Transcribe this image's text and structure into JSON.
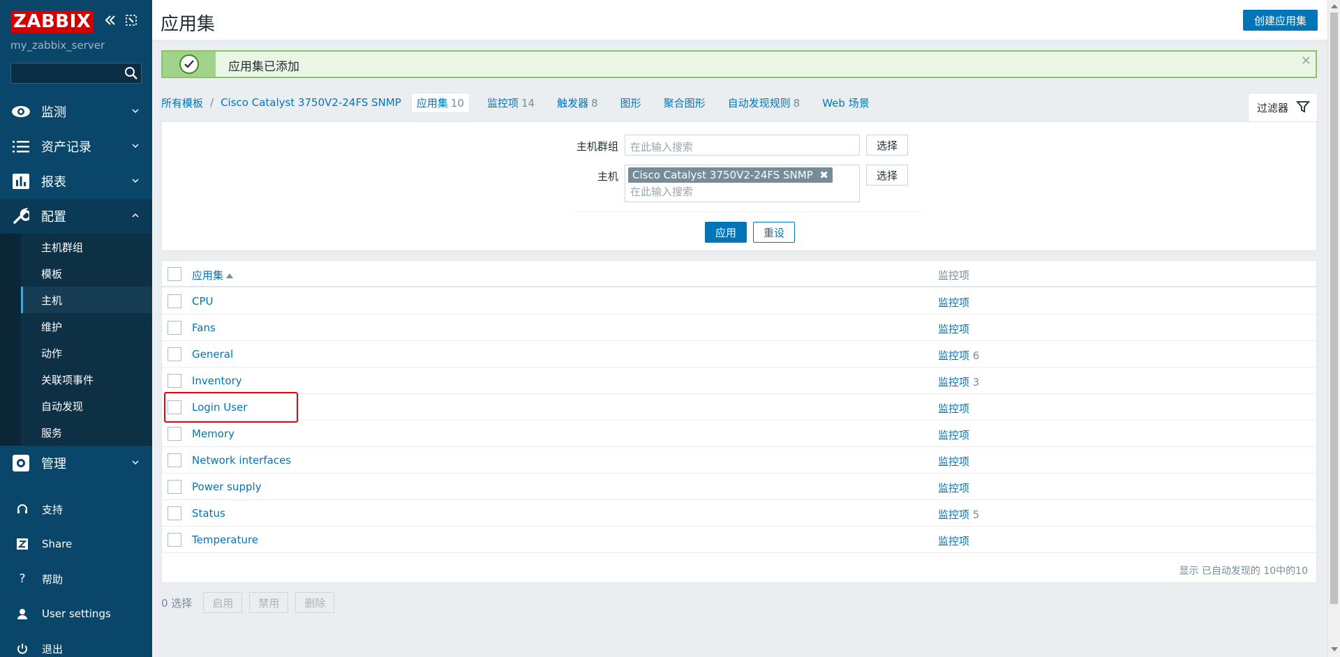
{
  "sidebar": {
    "logo": "ZABBIX",
    "server_name": "my_zabbix_server",
    "menu": [
      {
        "label": "监测",
        "icon": "eye-icon"
      },
      {
        "label": "资产记录",
        "icon": "list-icon"
      },
      {
        "label": "报表",
        "icon": "bar-chart-icon"
      },
      {
        "label": "配置",
        "icon": "wrench-icon"
      }
    ],
    "config_sub": [
      "主机群组",
      "模板",
      "主机",
      "维护",
      "动作",
      "关联项事件",
      "自动发现",
      "服务"
    ],
    "admin": {
      "label": "管理",
      "icon": "gear-icon"
    },
    "bottom": [
      {
        "label": "支持",
        "icon": "headset-icon"
      },
      {
        "label": "Share",
        "icon": "share-z-icon"
      },
      {
        "label": "帮助",
        "icon": "help-icon"
      },
      {
        "label": "User settings",
        "icon": "user-icon"
      },
      {
        "label": "退出",
        "icon": "power-icon"
      }
    ]
  },
  "header": {
    "title": "应用集",
    "create_button": "创建应用集"
  },
  "message": {
    "text": "应用集已添加",
    "close": "×"
  },
  "tabs": {
    "crumb_all": "所有模板",
    "crumb_sep": "/",
    "crumb_host": "Cisco Catalyst 3750V2-24FS SNMP",
    "items": [
      {
        "label": "应用集",
        "count": "10"
      },
      {
        "label": "监控项",
        "count": "14"
      },
      {
        "label": "触发器",
        "count": "8"
      },
      {
        "label": "图形",
        "count": ""
      },
      {
        "label": "聚合图形",
        "count": ""
      },
      {
        "label": "自动发现规则",
        "count": "8"
      },
      {
        "label": "Web 场景",
        "count": ""
      }
    ],
    "filter": "过滤器"
  },
  "filter": {
    "host_group_label": "主机群组",
    "host_label": "主机",
    "placeholder": "在此输入搜索",
    "host_chip": "Cisco Catalyst 3750V2-24FS SNMP",
    "chip_remove": "✖",
    "select": "选择",
    "apply": "应用",
    "reset": "重设"
  },
  "table": {
    "col_name": "应用集",
    "col_items": "监控项",
    "rows": [
      {
        "name": "CPU",
        "items": "监控项",
        "count": ""
      },
      {
        "name": "Fans",
        "items": "监控项",
        "count": ""
      },
      {
        "name": "General",
        "items": "监控项",
        "count": "6"
      },
      {
        "name": "Inventory",
        "items": "监控项",
        "count": "3"
      },
      {
        "name": "Login User",
        "items": "监控项",
        "count": ""
      },
      {
        "name": "Memory",
        "items": "监控项",
        "count": ""
      },
      {
        "name": "Network interfaces",
        "items": "监控项",
        "count": ""
      },
      {
        "name": "Power supply",
        "items": "监控项",
        "count": ""
      },
      {
        "name": "Status",
        "items": "监控项",
        "count": "5"
      },
      {
        "name": "Temperature",
        "items": "监控项",
        "count": ""
      }
    ],
    "footer": "显示 已自动发现的 10中的10"
  },
  "actions": {
    "selected": "0 选择",
    "enable": "启用",
    "disable": "禁用",
    "delete": "删除"
  },
  "colors": {
    "sidebar": "#0a466a",
    "accent": "#0275b8",
    "success_border": "#89c568",
    "highlight": "#e8000b"
  }
}
